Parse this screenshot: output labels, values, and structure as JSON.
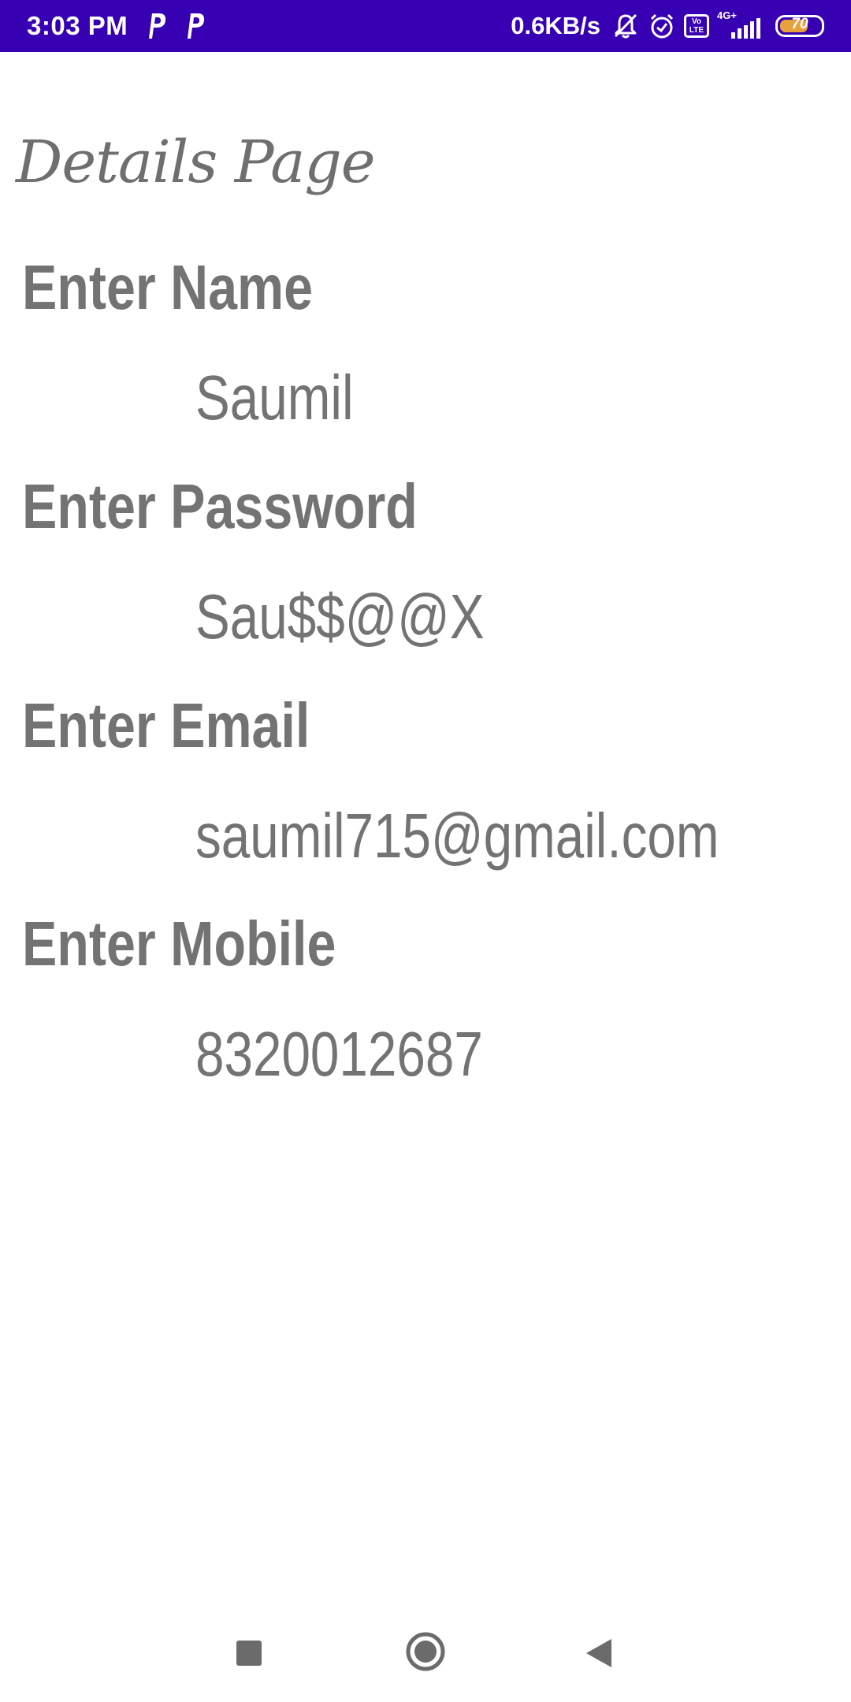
{
  "status_bar": {
    "time": "3:03 PM",
    "net_speed": "0.6KB/s",
    "network_type": "4G+",
    "volte_text": "Vo LTE",
    "battery_level": "70",
    "battery_fraction": 0.7,
    "background_color": "#3700b3",
    "icons": [
      "p-notification-icon",
      "p-notification-icon",
      "bell-off-icon",
      "alarm-icon",
      "volte-icon",
      "signal-icon",
      "battery-icon"
    ]
  },
  "page": {
    "title": "Details Page",
    "text_color": "#737373",
    "fields": [
      {
        "label": "Enter Name",
        "value": "Saumil"
      },
      {
        "label": "Enter Password",
        "value": "Sau$$@@X"
      },
      {
        "label": "Enter Email",
        "value": "saumil715@gmail.com"
      },
      {
        "label": "Enter Mobile",
        "value": "8320012687"
      }
    ]
  },
  "nav_bar": {
    "buttons": [
      "recent-apps-icon",
      "home-icon",
      "back-icon"
    ]
  }
}
